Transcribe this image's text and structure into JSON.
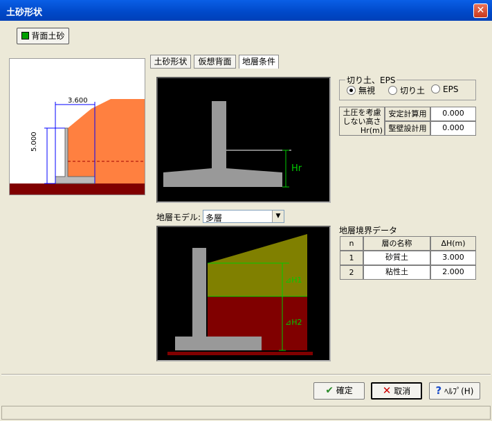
{
  "window": {
    "title": "土砂形状",
    "close_glyph": "✕"
  },
  "soil_tab": {
    "label": "背面土砂",
    "color": "#00a000"
  },
  "preview": {
    "dim_width": "3.600",
    "dim_height": "5.000"
  },
  "tabs": [
    {
      "label": "土砂形状"
    },
    {
      "label": "仮想背面"
    },
    {
      "label": "地層条件"
    }
  ],
  "cut": {
    "group_label": "切り土、EPS",
    "options": [
      {
        "label": "無視",
        "selected": true
      },
      {
        "label": "切り土",
        "selected": false
      },
      {
        "label": "EPS",
        "selected": false
      }
    ]
  },
  "height_table": {
    "header_line1": "土圧を考慮",
    "header_line2": "しない高さ",
    "header_line3": "Hr(m)",
    "rows": [
      {
        "label": "安定計算用",
        "value": "0.000"
      },
      {
        "label": "堅壁設計用",
        "value": "0.000"
      }
    ]
  },
  "diagram_top": {
    "label": "Hr"
  },
  "layer_model": {
    "label": "地層モデル:",
    "value": "多層"
  },
  "diagram_bottom": {
    "label1": "⊿H1",
    "label2": "⊿H2"
  },
  "boundary": {
    "title": "地層境界データ",
    "columns": [
      "n",
      "層の名称",
      "ΔH(m)"
    ],
    "rows": [
      {
        "n": "1",
        "name": "砂質土",
        "dh": "3.000"
      },
      {
        "n": "2",
        "name": "粘性土",
        "dh": "2.000"
      }
    ]
  },
  "buttons": {
    "ok": "確定",
    "cancel": "取消",
    "help": "ﾍﾙﾌﾟ(H)"
  },
  "colors": {
    "soil": "#ff8040",
    "ground": "#800000",
    "layer1": "#808000",
    "layer2": "#800000",
    "wall": "#808080",
    "dim": "#00cc00",
    "dimline": "#0000ff"
  }
}
